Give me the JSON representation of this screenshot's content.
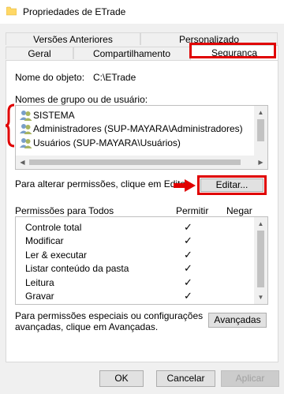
{
  "window": {
    "title": "Propriedades de ETrade"
  },
  "tabs": {
    "row1": [
      {
        "label": "Versões Anteriores"
      },
      {
        "label": "Personalizado"
      }
    ],
    "row2": [
      {
        "label": "Geral"
      },
      {
        "label": "Compartilhamento"
      },
      {
        "label": "Segurança",
        "active": true
      }
    ]
  },
  "object": {
    "name_label": "Nome do objeto:",
    "name_value": "C:\\ETrade"
  },
  "groups": {
    "label": "Nomes de grupo ou de usuário:",
    "items": [
      {
        "name": "SISTEMA",
        "icon": "users-icon"
      },
      {
        "name": "Administradores (SUP-MAYARA\\Administradores)",
        "icon": "users-icon"
      },
      {
        "name": "Usuários (SUP-MAYARA\\Usuários)",
        "icon": "users-icon"
      }
    ]
  },
  "edit": {
    "hint": "Para alterar permissões, clique em Editar.",
    "button_label": "Editar..."
  },
  "permissions": {
    "header_label": "Permissões para Todos",
    "allow_label": "Permitir",
    "deny_label": "Negar",
    "rows": [
      {
        "name": "Controle total",
        "allow": true,
        "deny": false
      },
      {
        "name": "Modificar",
        "allow": true,
        "deny": false
      },
      {
        "name": "Ler & executar",
        "allow": true,
        "deny": false
      },
      {
        "name": "Listar conteúdo da pasta",
        "allow": true,
        "deny": false
      },
      {
        "name": "Leitura",
        "allow": true,
        "deny": false
      },
      {
        "name": "Gravar",
        "allow": true,
        "deny": false
      }
    ],
    "check_glyph": "✓"
  },
  "advanced": {
    "hint_line1": "Para permissões especiais ou configurações",
    "hint_line2": "avançadas, clique em Avançadas.",
    "button_label": "Avançadas"
  },
  "footer": {
    "ok_label": "OK",
    "cancel_label": "Cancelar",
    "apply_label": "Aplicar"
  },
  "colors": {
    "highlight": "#e00000",
    "window_bg": "#f0f0f0",
    "panel_bg": "#ffffff"
  }
}
